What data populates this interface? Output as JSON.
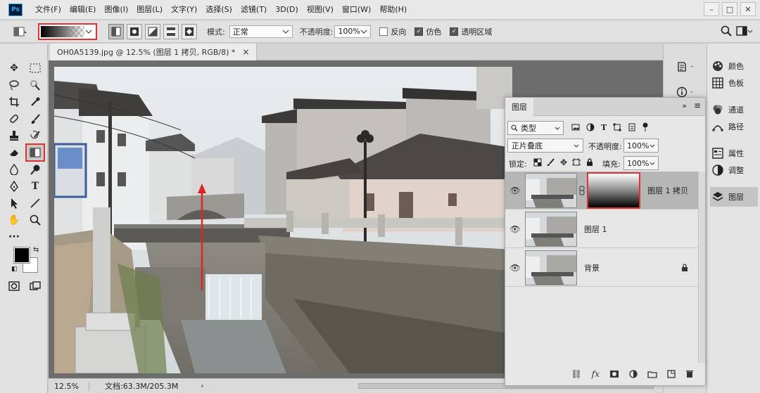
{
  "app": {
    "logo": "Ps"
  },
  "menu": [
    "文件(F)",
    "编辑(E)",
    "图像(I)",
    "图层(L)",
    "文字(Y)",
    "选择(S)",
    "滤镜(T)",
    "3D(D)",
    "视图(V)",
    "窗口(W)",
    "帮助(H)"
  ],
  "window_controls": [
    "–",
    "□",
    "✕"
  ],
  "options": {
    "mode_label": "模式:",
    "mode_value": "正常",
    "opacity_label": "不透明度:",
    "opacity_value": "100%",
    "reverse_label": "反向",
    "dither_label": "仿色",
    "transparency_label": "透明区域",
    "reverse_checked": false,
    "dither_checked": true,
    "transparency_checked": true
  },
  "document": {
    "tab_title": "OH0A5139.jpg @ 12.5% (图层 1 拷贝, RGB/8) *",
    "close": "×",
    "zoom": "12.5%",
    "file_info": "文档:63.3M/205.3M"
  },
  "right_panels": [
    {
      "label": "颜色",
      "icon": "palette-icon"
    },
    {
      "label": "色板",
      "icon": "grid-icon"
    },
    {
      "label": "通道",
      "icon": "channels-icon"
    },
    {
      "label": "路径",
      "icon": "path-icon"
    },
    {
      "label": "属性",
      "icon": "properties-icon"
    },
    {
      "label": "调整",
      "icon": "adjust-icon"
    },
    {
      "label": "图层",
      "icon": "layers-icon"
    }
  ],
  "layers_panel": {
    "tab": "图层",
    "filter_kind": "类型",
    "blend_mode": "正片叠底",
    "opacity_label": "不透明度:",
    "opacity": "100%",
    "lock_label": "锁定:",
    "fill_label": "填充:",
    "fill": "100%",
    "layers": [
      {
        "name": "图层 1 拷贝",
        "selected": true,
        "has_mask": true
      },
      {
        "name": "图层 1",
        "selected": false,
        "has_mask": false
      },
      {
        "name": "背景",
        "selected": false,
        "has_mask": false,
        "locked": true
      }
    ]
  },
  "colors": {
    "accent_red": "#d33333",
    "selected_row": "#b6b6b6"
  }
}
